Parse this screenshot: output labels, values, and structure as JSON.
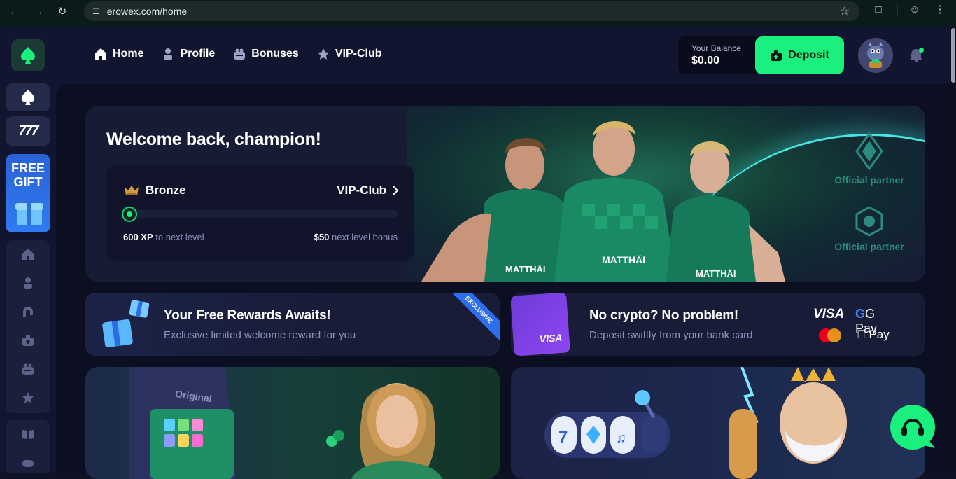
{
  "browser": {
    "url": "erowex.com/home"
  },
  "nav": {
    "items": [
      {
        "label": "Home",
        "icon": "home-icon"
      },
      {
        "label": "Profile",
        "icon": "user-icon"
      },
      {
        "label": "Bonuses",
        "icon": "gift-icon"
      },
      {
        "label": "VIP-Club",
        "icon": "star-icon"
      }
    ]
  },
  "balance": {
    "label": "Your Balance",
    "dollars": "$0",
    "cents": ".00"
  },
  "deposit": {
    "label": "Deposit"
  },
  "sidebar": {
    "gift_label_1": "FREE",
    "gift_label_2": "GIFT",
    "slots_label": "777"
  },
  "hero": {
    "title": "Welcome back, champion!",
    "tier": "Bronze",
    "vip_link": "VIP-Club",
    "xp_amount": "600 XP",
    "xp_text": " to next level",
    "bonus_amount": "$50",
    "bonus_text": " next level bonus",
    "progress": 0.0,
    "partner_label_1": "Official partner",
    "partner_label_2": "Official partner"
  },
  "banners": {
    "rewards": {
      "title": "Your Free Rewards Awaits!",
      "subtitle": "Exclusive limited welcome reward for you",
      "ribbon": "EXCLUSIVE"
    },
    "crypto": {
      "title": "No crypto? No problem!",
      "subtitle": "Deposit swiftly from your bank card",
      "card_brand": "VISA",
      "logo_visa": "VISA",
      "logo_gpay": "G Pay",
      "logo_apay": " Pay"
    }
  },
  "tiles": {
    "originals_label": "Original"
  },
  "colors": {
    "accent": "#19f07e",
    "background": "#0c0e22",
    "panel": "#171b34"
  }
}
